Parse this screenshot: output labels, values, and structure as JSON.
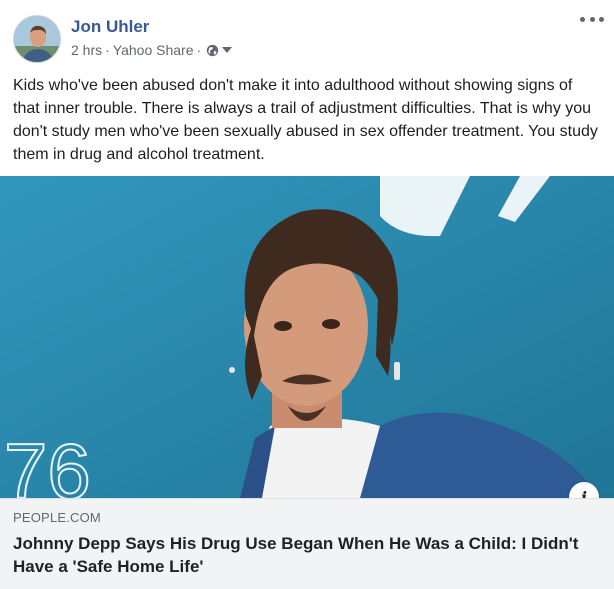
{
  "post": {
    "author": "Jon Uhler",
    "time": "2 hrs",
    "source": "Yahoo Share",
    "separator": "·",
    "privacy_icon": "globe-icon",
    "text": "Kids who've been abused don't make it into adulthood without showing signs of that inner trouble. There is always a trail of adjustment difficulties. That is why you don't study men who've been sexually abused in sex offender treatment. You study them in drug and alcohol treatment."
  },
  "link": {
    "domain": "PEOPLE.COM",
    "title": "Johnny Depp Says His Drug Use Began When He Was a Child: I Didn't Have a 'Safe Home Life'",
    "image_bg_text": "76",
    "info_label": "i"
  },
  "colors": {
    "author": "#385898",
    "meta": "#606770",
    "backdrop": "#2b8ab0",
    "footer_bg": "#f2f3f5"
  }
}
